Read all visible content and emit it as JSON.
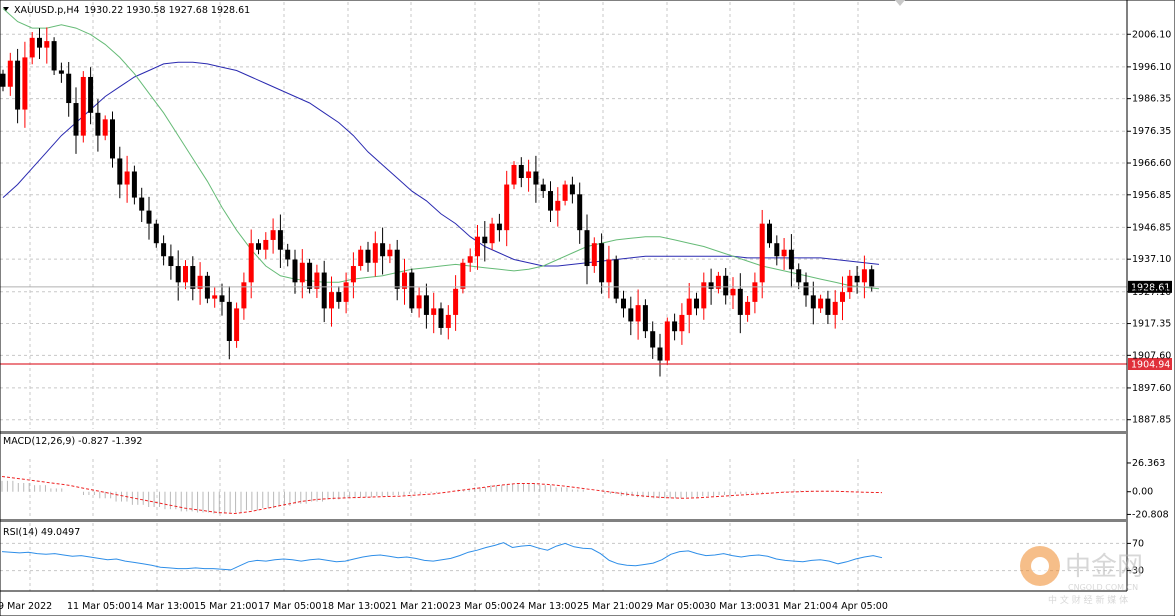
{
  "header": {
    "symbol": "XAUUSD.p,H4",
    "ohlc": "1930.22 1930.58 1927.68 1928.61"
  },
  "watermark": {
    "brand": "中金网",
    "domain": "CNGOLD.COM.CN",
    "tagline": "中 文 财 经 新 媒 体"
  },
  "colors": {
    "bull": "#ff0000",
    "bear": "#000000",
    "ma_fast": "#66bb77",
    "ma_slow": "#2a2ab0",
    "support": "#e0303a",
    "macd_signal": "#ee2222",
    "rsi": "#2e8ee8",
    "grid": "#c8c8c8"
  },
  "chart_data": [
    {
      "type": "candlestick",
      "title": "XAUUSD.p,H4",
      "ylim": [
        1885.0,
        2016.0
      ],
      "y_ticks": [
        "2006.10",
        "1996.10",
        "1986.35",
        "1976.35",
        "1966.60",
        "1956.85",
        "1946.85",
        "1937.10",
        "1927.10",
        "1917.35",
        "1907.60",
        "1897.60",
        "1887.85"
      ],
      "x_ticks": [
        "9 Mar 2022",
        "11 Mar 05:00",
        "14 Mar 13:00",
        "15 Mar 21:00",
        "17 Mar 05:00",
        "18 Mar 13:00",
        "21 Mar 21:00",
        "23 Mar 05:00",
        "24 Mar 13:00",
        "25 Mar 21:00",
        "29 Mar 05:00",
        "30 Mar 13:00",
        "31 Mar 21:00",
        "4 Apr 05:00"
      ],
      "current_price": "1928.61",
      "support_level": "1904.94",
      "closes": [
        1990,
        1998,
        1983,
        1999,
        2005,
        2002,
        2004,
        1995,
        1994,
        1985,
        1975,
        1993,
        1982,
        1975,
        1980,
        1968,
        1960,
        1964,
        1956,
        1952,
        1948,
        1942,
        1938,
        1935,
        1930,
        1935,
        1928,
        1932,
        1925,
        1926,
        1924,
        1912,
        1922,
        1930,
        1942,
        1940,
        1943,
        1946,
        1940,
        1937,
        1930,
        1936,
        1928,
        1933,
        1922,
        1927,
        1924,
        1930,
        1935,
        1940,
        1936,
        1942,
        1938,
        1940,
        1928,
        1933,
        1922,
        1926,
        1920,
        1922,
        1916,
        1920,
        1928,
        1936,
        1938,
        1944,
        1942,
        1948,
        1946,
        1960,
        1966,
        1962,
        1964,
        1960,
        1958,
        1952,
        1955,
        1960,
        1957,
        1946,
        1935,
        1942,
        1930,
        1937,
        1925,
        1922,
        1918,
        1923,
        1915,
        1910,
        1906,
        1918,
        1915,
        1920,
        1925,
        1922,
        1930,
        1928,
        1932,
        1926,
        1928,
        1920,
        1924,
        1930,
        1948,
        1942,
        1938,
        1940,
        1934,
        1930,
        1926,
        1922,
        1925,
        1920,
        1924,
        1927,
        1932,
        1930,
        1934,
        1928.61
      ],
      "ma_fast": [
        2014,
        2010,
        2008,
        2008,
        2009,
        2008,
        2006,
        2003,
        1999,
        1994,
        1988,
        1982,
        1975,
        1968,
        1961,
        1953,
        1946,
        1940,
        1935,
        1932,
        1931,
        1930.5,
        1930,
        1930,
        1931,
        1931.5,
        1932,
        1933,
        1934,
        1934.5,
        1935,
        1935.5,
        1935,
        1934.5,
        1934,
        1933.5,
        1934,
        1935,
        1937,
        1939,
        1941,
        1942,
        1943,
        1943.5,
        1944,
        1944,
        1943,
        1942,
        1941,
        1939.5,
        1938,
        1936.5,
        1935,
        1934,
        1933,
        1932,
        1931,
        1930,
        1929,
        1928.5,
        1928
      ],
      "ma_slow": [
        1956,
        1960,
        1965,
        1970,
        1975,
        1979,
        1983,
        1987,
        1990,
        1993,
        1995,
        1997,
        1997.5,
        1997.5,
        1997,
        1996,
        1995,
        1993,
        1991,
        1989,
        1987,
        1985,
        1982,
        1979,
        1975,
        1970,
        1966,
        1962,
        1958,
        1955,
        1951,
        1948,
        1944,
        1941,
        1939,
        1937,
        1936,
        1935,
        1935,
        1935.5,
        1936,
        1936.5,
        1937,
        1937.5,
        1938,
        1938,
        1938,
        1938,
        1938,
        1938,
        1938,
        1937.5,
        1937.5,
        1937.5,
        1937.5,
        1937.5,
        1937.5,
        1937,
        1936.5,
        1936,
        1935.5
      ],
      "ma_x_range": [
        0,
        120
      ]
    },
    {
      "type": "line",
      "title": "MACD(12,26,9) -0.827 -1.392",
      "ylim": [
        -25,
        30
      ],
      "y_ticks": [
        "26.363",
        "0.00",
        "-20.808"
      ],
      "histogram": [
        10,
        8,
        6,
        3,
        0,
        -3,
        -6,
        -9,
        -12,
        -14,
        -16,
        -18,
        -19,
        -20,
        -19,
        -17,
        -15,
        -13,
        -11,
        -9,
        -7,
        -6,
        -5,
        -4,
        -3,
        -2,
        -1,
        0,
        2,
        4,
        6,
        7,
        8,
        6,
        4,
        2,
        0,
        -2,
        -4,
        -5,
        -6,
        -6,
        -5,
        -4,
        -3,
        -2,
        -1,
        0,
        0.5,
        1,
        1,
        0.5,
        0,
        0
      ],
      "signal": [
        14,
        12,
        10,
        8,
        6,
        3,
        0,
        -3,
        -6,
        -9,
        -12,
        -15,
        -17,
        -19,
        -20,
        -18,
        -15,
        -12,
        -9,
        -7,
        -6,
        -5.5,
        -5,
        -4.5,
        -4,
        -3,
        -2,
        0,
        2,
        4,
        6,
        7.5,
        7.5,
        6.5,
        5,
        3,
        1,
        -1,
        -3,
        -4.5,
        -5.5,
        -6,
        -5.5,
        -4.5,
        -3.5,
        -2.5,
        -1.5,
        -0.5,
        0,
        0.5,
        0.5,
        0,
        -0.5,
        -0.8
      ]
    },
    {
      "type": "line",
      "title": "RSI(14) 49.0497",
      "ylim": [
        0,
        100
      ],
      "y_ticks": [
        "70",
        "30"
      ],
      "values": [
        58,
        57,
        56,
        57,
        55,
        54,
        55,
        53,
        51,
        52,
        50,
        48,
        46,
        47,
        44,
        42,
        40,
        38,
        35,
        34,
        33,
        33,
        34,
        33,
        33,
        32,
        31,
        37,
        43,
        45,
        44,
        46,
        47,
        46,
        44,
        46,
        47,
        45,
        43,
        44,
        47,
        50,
        52,
        53,
        51,
        49,
        50,
        48,
        45,
        44,
        46,
        48,
        52,
        57,
        60,
        64,
        67,
        71,
        64,
        66,
        67,
        63,
        60,
        66,
        70,
        65,
        63,
        62,
        55,
        45,
        40,
        38,
        37,
        39,
        41,
        46,
        54,
        58,
        59,
        55,
        52,
        53,
        55,
        52,
        50,
        52,
        53,
        51,
        47,
        45,
        44,
        43,
        45,
        46,
        44,
        40,
        43,
        47,
        50,
        52,
        49
      ]
    }
  ]
}
